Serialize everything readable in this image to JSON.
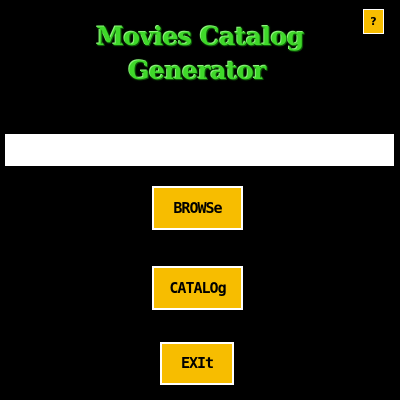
{
  "app": {
    "title_line1": "Movies Catalog",
    "title_line2": "Generator"
  },
  "help": {
    "label": "?"
  },
  "path_field": {
    "value": "",
    "placeholder": ""
  },
  "buttons": {
    "browse_label": "BROWSe",
    "catalog_label": "CATALOg",
    "exit_label": "EXIt"
  },
  "colors": {
    "background": "#000000",
    "title_green": "#3fd82a",
    "button_yellow": "#f7bd00",
    "input_white": "#ffffff"
  }
}
